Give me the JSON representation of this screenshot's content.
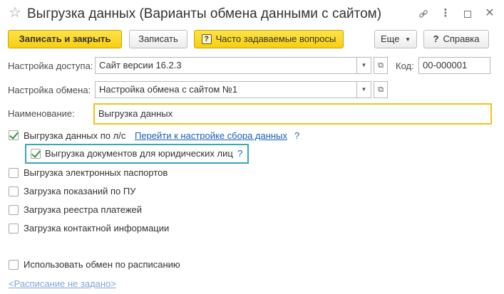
{
  "window": {
    "title": "Выгрузка данных (Варианты обмена данными с сайтом)",
    "star_icon": "star-icon",
    "link_icon": "link-icon",
    "more_icon": "vertical-dots-icon",
    "maximize_icon": "maximize-icon",
    "close_icon": "close-icon"
  },
  "toolbar": {
    "save_close_label": "Записать и закрыть",
    "save_label": "Записать",
    "faq_label": "Часто задаваемые вопросы",
    "faq_icon": "question-icon",
    "more_label": "Еще",
    "help_label": "Справка",
    "help_icon": "question-icon"
  },
  "form": {
    "access_label": "Настройка доступа:",
    "access_value": "Сайт версии 16.2.3",
    "code_label": "Код:",
    "code_value": "00-000001",
    "exchange_label": "Настройка обмена:",
    "exchange_value": "Настройка обмена с сайтом №1",
    "name_label": "Наименование:",
    "name_value": "Выгрузка данных"
  },
  "options": {
    "ls_export": {
      "label": "Выгрузка данных по л/с",
      "checked": true
    },
    "ls_link": "Перейти к настройке сбора данных",
    "ls_help": "?",
    "legal_docs": {
      "label": "Выгрузка документов для юридических лиц",
      "checked": true,
      "help": "?"
    },
    "passports": {
      "label": "Выгрузка электронных паспортов",
      "checked": false
    },
    "meter_readings": {
      "label": "Загрузка показаний по ПУ",
      "checked": false
    },
    "payments_registry": {
      "label": "Загрузка реестра платежей",
      "checked": false
    },
    "contact_info": {
      "label": "Загрузка контактной информации",
      "checked": false
    },
    "use_schedule": {
      "label": "Использовать обмен по расписанию",
      "checked": false
    },
    "schedule_link": "<Расписание не задано>"
  },
  "colors": {
    "primary_button": "#f7cf0f",
    "name_field_border": "#f2c21a",
    "highlight_border": "#3aa6b9",
    "link": "#1a5fb4",
    "check": "#3a9a3a"
  }
}
